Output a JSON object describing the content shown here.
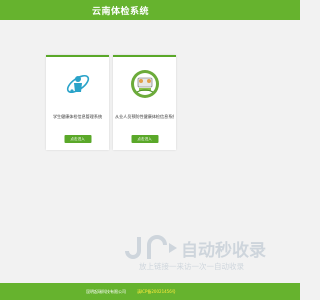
{
  "header": {
    "title": "云南体检系统"
  },
  "cards": [
    {
      "title": "学生健康体检信息管理系统",
      "button_label": "点击进入",
      "icon": "student-health-icon"
    },
    {
      "title": "从业人员预防性健康体检信息系统",
      "button_label": "点击进入",
      "icon": "worker-health-icon"
    }
  ],
  "watermark": {
    "big_text": "自动秒收录",
    "small_text": "放上链接一来访一次一自动收录",
    "logo_letters": "JR"
  },
  "footer": {
    "company": "昆明起瑞科技有限公司",
    "icp": "滇ICP备20021456号"
  },
  "colors": {
    "brand_green": "#66b32e",
    "button_green": "#5aa829",
    "footer_link": "#ffeb3b"
  }
}
